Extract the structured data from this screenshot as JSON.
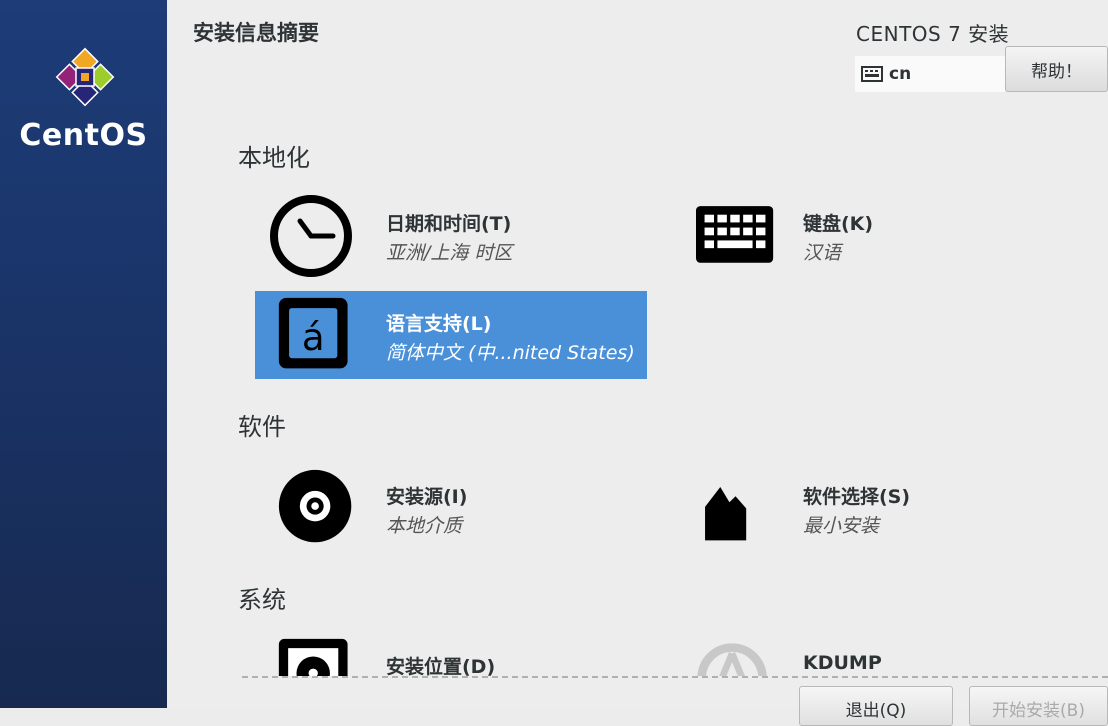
{
  "sidebar": {
    "brand": "CentOS",
    "logo_colors": [
      "#932279",
      "#efa724",
      "#262577",
      "#9ccd2a"
    ]
  },
  "header": {
    "title": "安装信息摘要",
    "product": "CENTOS 7 安装",
    "keyboard_layout": "cn",
    "help_label": "帮助！"
  },
  "sections": [
    {
      "title": "本地化",
      "spokes": [
        {
          "title": "日期和时间(T)",
          "status": "亚洲/上海 时区",
          "icon": "clock-icon"
        },
        {
          "title": "键盘(K)",
          "status": "汉语",
          "icon": "keyboard-icon"
        },
        {
          "title": "语言支持(L)",
          "status": "简体中文 (中...nited States)",
          "icon": "language-icon",
          "selected": true
        }
      ]
    },
    {
      "title": "软件",
      "spokes": [
        {
          "title": "安装源(I)",
          "status": "本地介质",
          "icon": "disc-icon"
        },
        {
          "title": "软件选择(S)",
          "status": "最小安装",
          "icon": "package-icon"
        }
      ]
    },
    {
      "title": "系统",
      "spokes": [
        {
          "title": "安装位置(D)",
          "status": "",
          "icon": "harddisk-icon"
        },
        {
          "title": "KDUMP",
          "status": "",
          "icon": "kdump-icon"
        }
      ]
    }
  ],
  "footer": {
    "quit_label": "退出(Q)",
    "begin_label": "开始安装(B)"
  },
  "colors": {
    "selected": "#4a90d9",
    "sidebar": "#1d3c78",
    "background": "#ededed"
  }
}
